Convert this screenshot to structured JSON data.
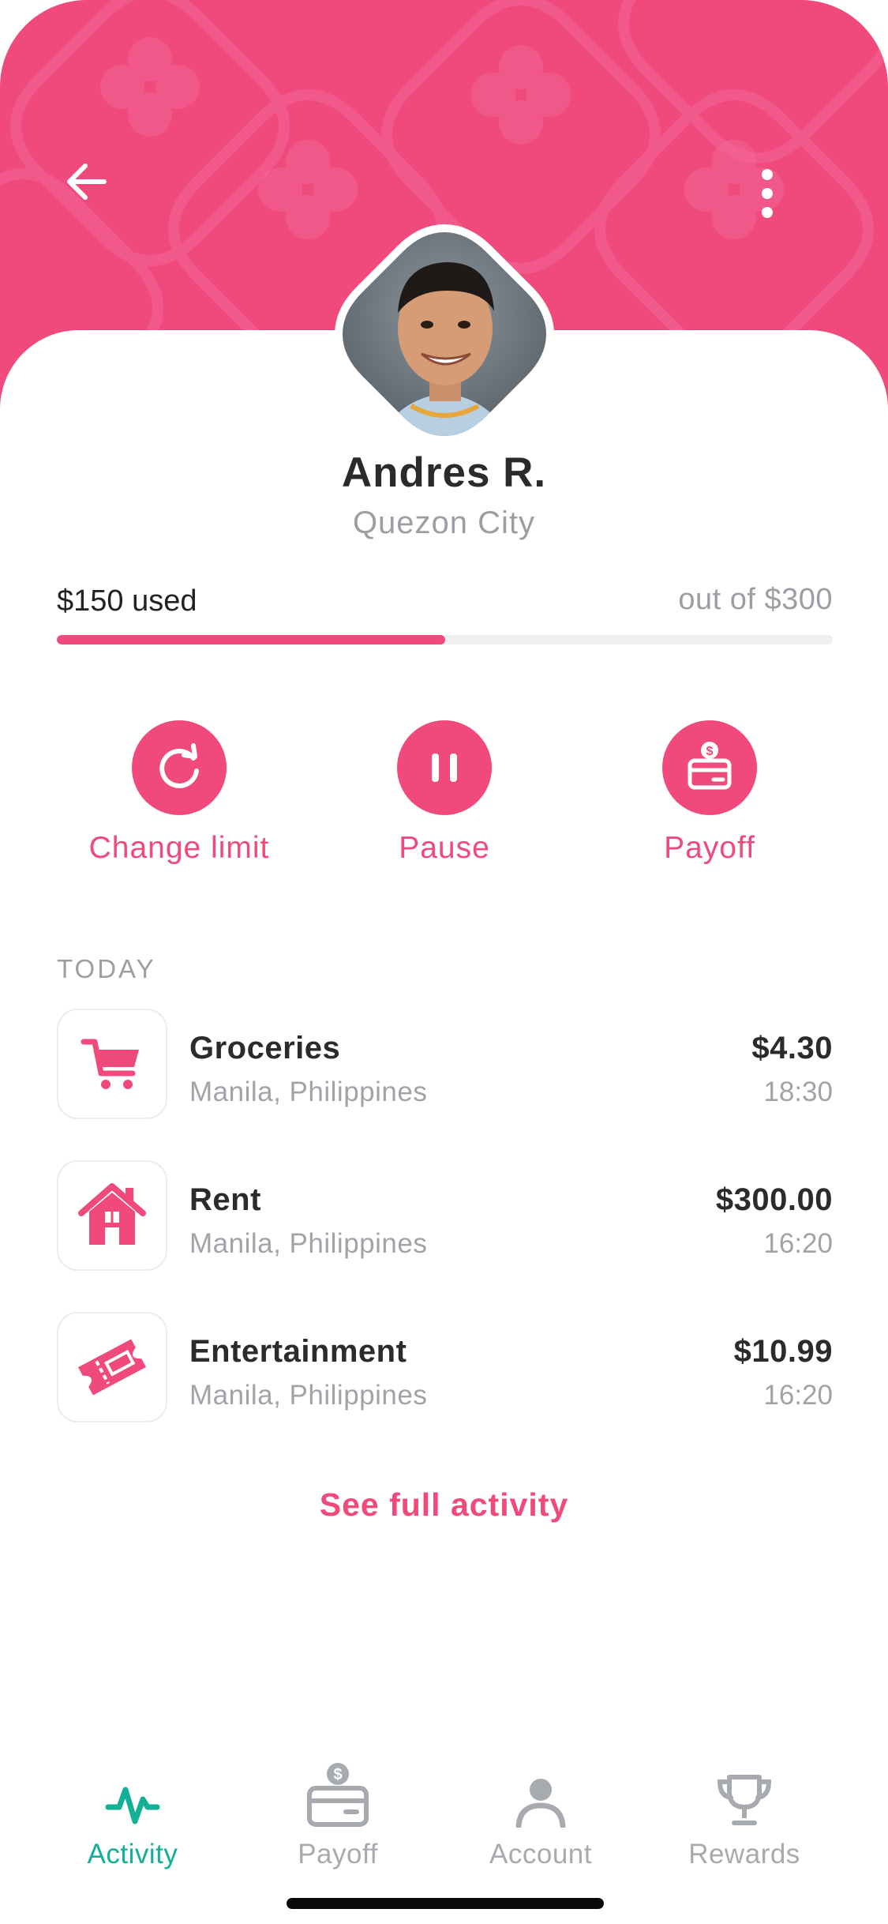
{
  "colors": {
    "brand": "#ef4a7b",
    "active_tab": "#14b096",
    "muted_text": "#9b9fa4",
    "text": "#2b2b2b"
  },
  "header": {
    "back_icon": "arrow-left-icon",
    "more_icon": "more-vertical-icon"
  },
  "profile": {
    "name": "Andres R.",
    "city": "Quezon City",
    "avatar": "profile-photo"
  },
  "limit": {
    "used_label": "$150 used",
    "total_label": "out of $300",
    "used_fraction": 0.5
  },
  "actions": [
    {
      "label": "Change limit",
      "icon": "refresh-icon"
    },
    {
      "label": "Pause",
      "icon": "pause-icon"
    },
    {
      "label": "Payoff",
      "icon": "card-dollar-icon"
    }
  ],
  "activity": {
    "section_label": "TODAY",
    "transactions": [
      {
        "category": "Groceries",
        "location": "Manila, Philippines",
        "amount": "$4.30",
        "time": "18:30",
        "icon": "cart-icon"
      },
      {
        "category": "Rent",
        "location": "Manila, Philippines",
        "amount": "$300.00",
        "time": "16:20",
        "icon": "house-icon"
      },
      {
        "category": "Entertainment",
        "location": "Manila, Philippines",
        "amount": "$10.99",
        "time": "16:20",
        "icon": "ticket-icon"
      }
    ],
    "see_all_label": "See full activity"
  },
  "tabs": [
    {
      "label": "Activity",
      "icon": "activity-icon",
      "active": true
    },
    {
      "label": "Payoff",
      "icon": "card-dollar-icon",
      "active": false
    },
    {
      "label": "Account",
      "icon": "user-icon",
      "active": false
    },
    {
      "label": "Rewards",
      "icon": "trophy-icon",
      "active": false
    }
  ]
}
